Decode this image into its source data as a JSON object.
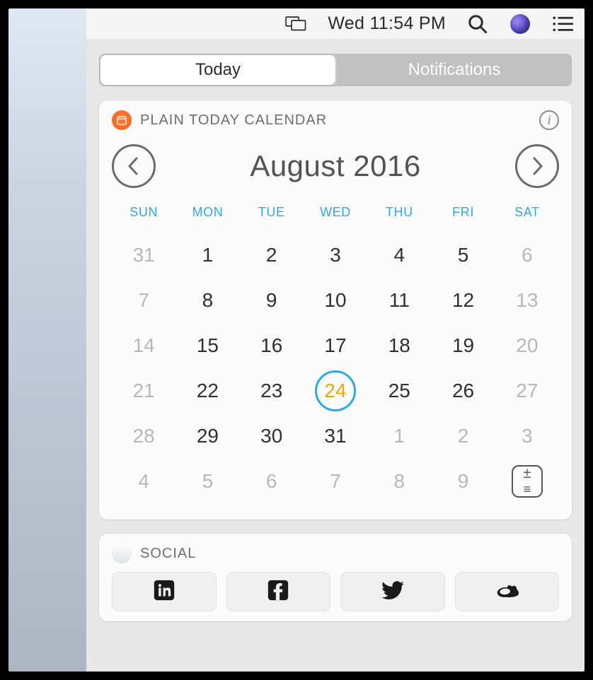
{
  "menubar": {
    "clock": "Wed 11:54 PM"
  },
  "segmented": {
    "today": "Today",
    "notifications": "Notifications",
    "active": "today"
  },
  "calendar_widget": {
    "title": "PLAIN TODAY CALENDAR",
    "month_label": "August 2016",
    "weekdays": [
      "SUN",
      "MON",
      "TUE",
      "WED",
      "THU",
      "FRI",
      "SAT"
    ],
    "cells": [
      {
        "n": "31",
        "out": true
      },
      {
        "n": "1"
      },
      {
        "n": "2"
      },
      {
        "n": "3"
      },
      {
        "n": "4"
      },
      {
        "n": "5"
      },
      {
        "n": "6",
        "out": true
      },
      {
        "n": "7",
        "out": true
      },
      {
        "n": "8"
      },
      {
        "n": "9"
      },
      {
        "n": "10"
      },
      {
        "n": "11"
      },
      {
        "n": "12"
      },
      {
        "n": "13",
        "out": true
      },
      {
        "n": "14",
        "out": true
      },
      {
        "n": "15"
      },
      {
        "n": "16"
      },
      {
        "n": "17"
      },
      {
        "n": "18"
      },
      {
        "n": "19"
      },
      {
        "n": "20",
        "out": true
      },
      {
        "n": "21",
        "out": true
      },
      {
        "n": "22"
      },
      {
        "n": "23"
      },
      {
        "n": "24",
        "today": true
      },
      {
        "n": "25"
      },
      {
        "n": "26"
      },
      {
        "n": "27",
        "out": true
      },
      {
        "n": "28",
        "out": true
      },
      {
        "n": "29"
      },
      {
        "n": "30"
      },
      {
        "n": "31"
      },
      {
        "n": "1",
        "out": true
      },
      {
        "n": "2",
        "out": true
      },
      {
        "n": "3",
        "out": true
      },
      {
        "n": "4",
        "out": true
      },
      {
        "n": "5",
        "out": true
      },
      {
        "n": "6",
        "out": true
      },
      {
        "n": "7",
        "out": true
      },
      {
        "n": "8",
        "out": true
      },
      {
        "n": "9",
        "out": true
      },
      {
        "expand": true
      }
    ]
  },
  "social_widget": {
    "title": "SOCIAL",
    "items": [
      "linkedin",
      "facebook",
      "twitter",
      "weibo"
    ]
  }
}
